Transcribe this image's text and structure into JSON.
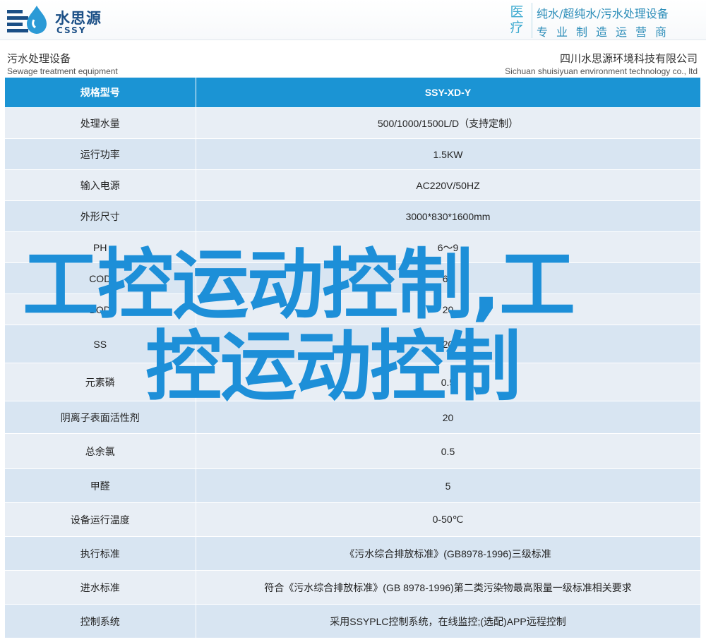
{
  "header": {
    "logo_cn": "水思源",
    "logo_en": "CSSY",
    "medical_label": "医疗",
    "slogan_line1": "纯水/超纯水/污水处理设备",
    "slogan_line2": "专业制造运营商"
  },
  "title": {
    "left_cn": "污水处理设备",
    "left_en": "Sewage treatment equipment",
    "right_cn": "四川水思源环境科技有限公司",
    "right_en": "Sichuan shuisiyuan environment technology co., ltd"
  },
  "table": {
    "header": [
      "规格型号",
      "SSY-XD-Y"
    ],
    "rows": [
      [
        "处理水量",
        "500/1000/1500L/D（支持定制）"
      ],
      [
        "运行功率",
        "1.5KW"
      ],
      [
        "输入电源",
        "AC220V/50HZ"
      ],
      [
        "外形尺寸",
        "3000*830*1600mm"
      ],
      [
        "PH",
        "6～9"
      ],
      [
        "COD",
        "60"
      ],
      [
        "BOD",
        "20"
      ],
      [
        "SS",
        "20"
      ],
      [
        "元素磷",
        "0.5"
      ],
      [
        "阴离子表面活性剂",
        "20"
      ],
      [
        "总余氯",
        "0.5"
      ],
      [
        "甲醛",
        "5"
      ],
      [
        "设备运行温度",
        "0-50℃"
      ],
      [
        "执行标准",
        "《污水综合排放标准》(GB8978-1996)三级标准"
      ],
      [
        "进水标准",
        "符合《污水综合排放标准》(GB 8978-1996)第二类污染物最高限量一级标准相关要求"
      ],
      [
        "控制系统",
        "采用SSYPLC控制系统，在线监控;(选配)APP远程控制"
      ]
    ]
  },
  "overlay": {
    "line1": "工控运动控制,工",
    "line2": "控运动控制"
  },
  "colors": {
    "brand": "#1b4f86",
    "accent": "#1b94d4",
    "overlay_text": "#1d8fd8",
    "row_light": "#e8eef5",
    "row_dark": "#d8e5f2"
  }
}
